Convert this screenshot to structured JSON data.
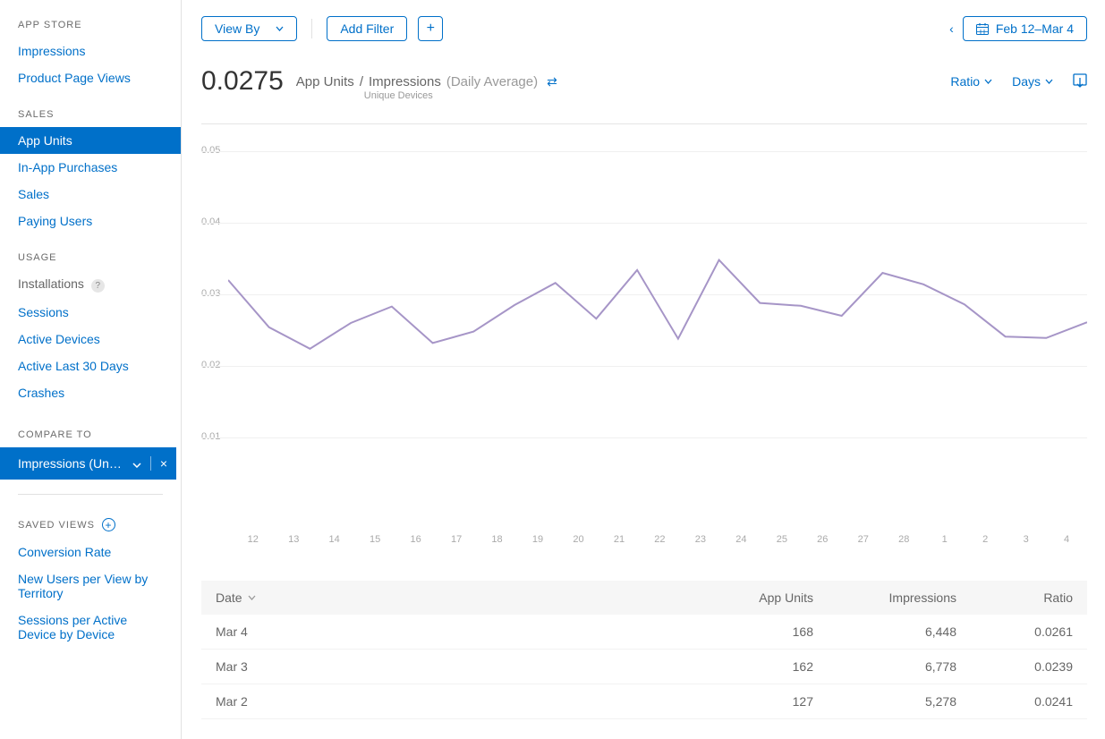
{
  "sidebar": {
    "sections": {
      "appstore": {
        "title": "APP STORE",
        "items": [
          "Impressions",
          "Product Page Views"
        ]
      },
      "sales": {
        "title": "SALES",
        "items": [
          "App Units",
          "In-App Purchases",
          "Sales",
          "Paying Users"
        ],
        "active": "App Units"
      },
      "usage": {
        "title": "USAGE",
        "items": [
          "Installations",
          "Sessions",
          "Active Devices",
          "Active Last 30 Days",
          "Crashes"
        ],
        "help_on": "Installations"
      }
    },
    "compare": {
      "title": "COMPARE TO",
      "selected": "Impressions (Unique…"
    },
    "saved_views": {
      "title": "SAVED VIEWS",
      "items": [
        "Conversion Rate",
        "New Users per View by Territory",
        "Sessions per Active Device by Device"
      ]
    }
  },
  "topbar": {
    "view_by": "View By",
    "add_filter": "Add Filter",
    "date_range": "Feb 12–Mar 4"
  },
  "header": {
    "value": "0.0275",
    "metric_a": "App Units",
    "sep": "/",
    "metric_b": "Impressions",
    "qualifier": "(Daily Average)",
    "sub": "Unique Devices",
    "ratio": "Ratio",
    "days": "Days"
  },
  "table": {
    "columns": {
      "date": "Date",
      "units": "App Units",
      "imp": "Impressions",
      "ratio": "Ratio"
    },
    "rows": [
      {
        "date": "Mar 4",
        "units": "168",
        "imp": "6,448",
        "ratio": "0.0261"
      },
      {
        "date": "Mar 3",
        "units": "162",
        "imp": "6,778",
        "ratio": "0.0239"
      },
      {
        "date": "Mar 2",
        "units": "127",
        "imp": "5,278",
        "ratio": "0.0241"
      }
    ]
  },
  "chart_data": {
    "type": "line",
    "xlabel": "",
    "ylabel": "",
    "ylim": [
      0,
      0.05
    ],
    "yticks": [
      0.01,
      0.02,
      0.03,
      0.04,
      0.05
    ],
    "categories": [
      "12",
      "13",
      "14",
      "15",
      "16",
      "17",
      "18",
      "19",
      "20",
      "21",
      "22",
      "23",
      "24",
      "25",
      "26",
      "27",
      "28",
      "1",
      "2",
      "3",
      "4"
    ],
    "series": [
      {
        "name": "App Units / Impressions",
        "color": "#a695c7",
        "values": [
          0.032,
          0.0254,
          0.0224,
          0.026,
          0.0283,
          0.0232,
          0.0248,
          0.0285,
          0.0316,
          0.0266,
          0.0334,
          0.0238,
          0.0348,
          0.0288,
          0.0284,
          0.027,
          0.033,
          0.0314,
          0.0286,
          0.0241,
          0.0239,
          0.0261
        ]
      }
    ]
  }
}
